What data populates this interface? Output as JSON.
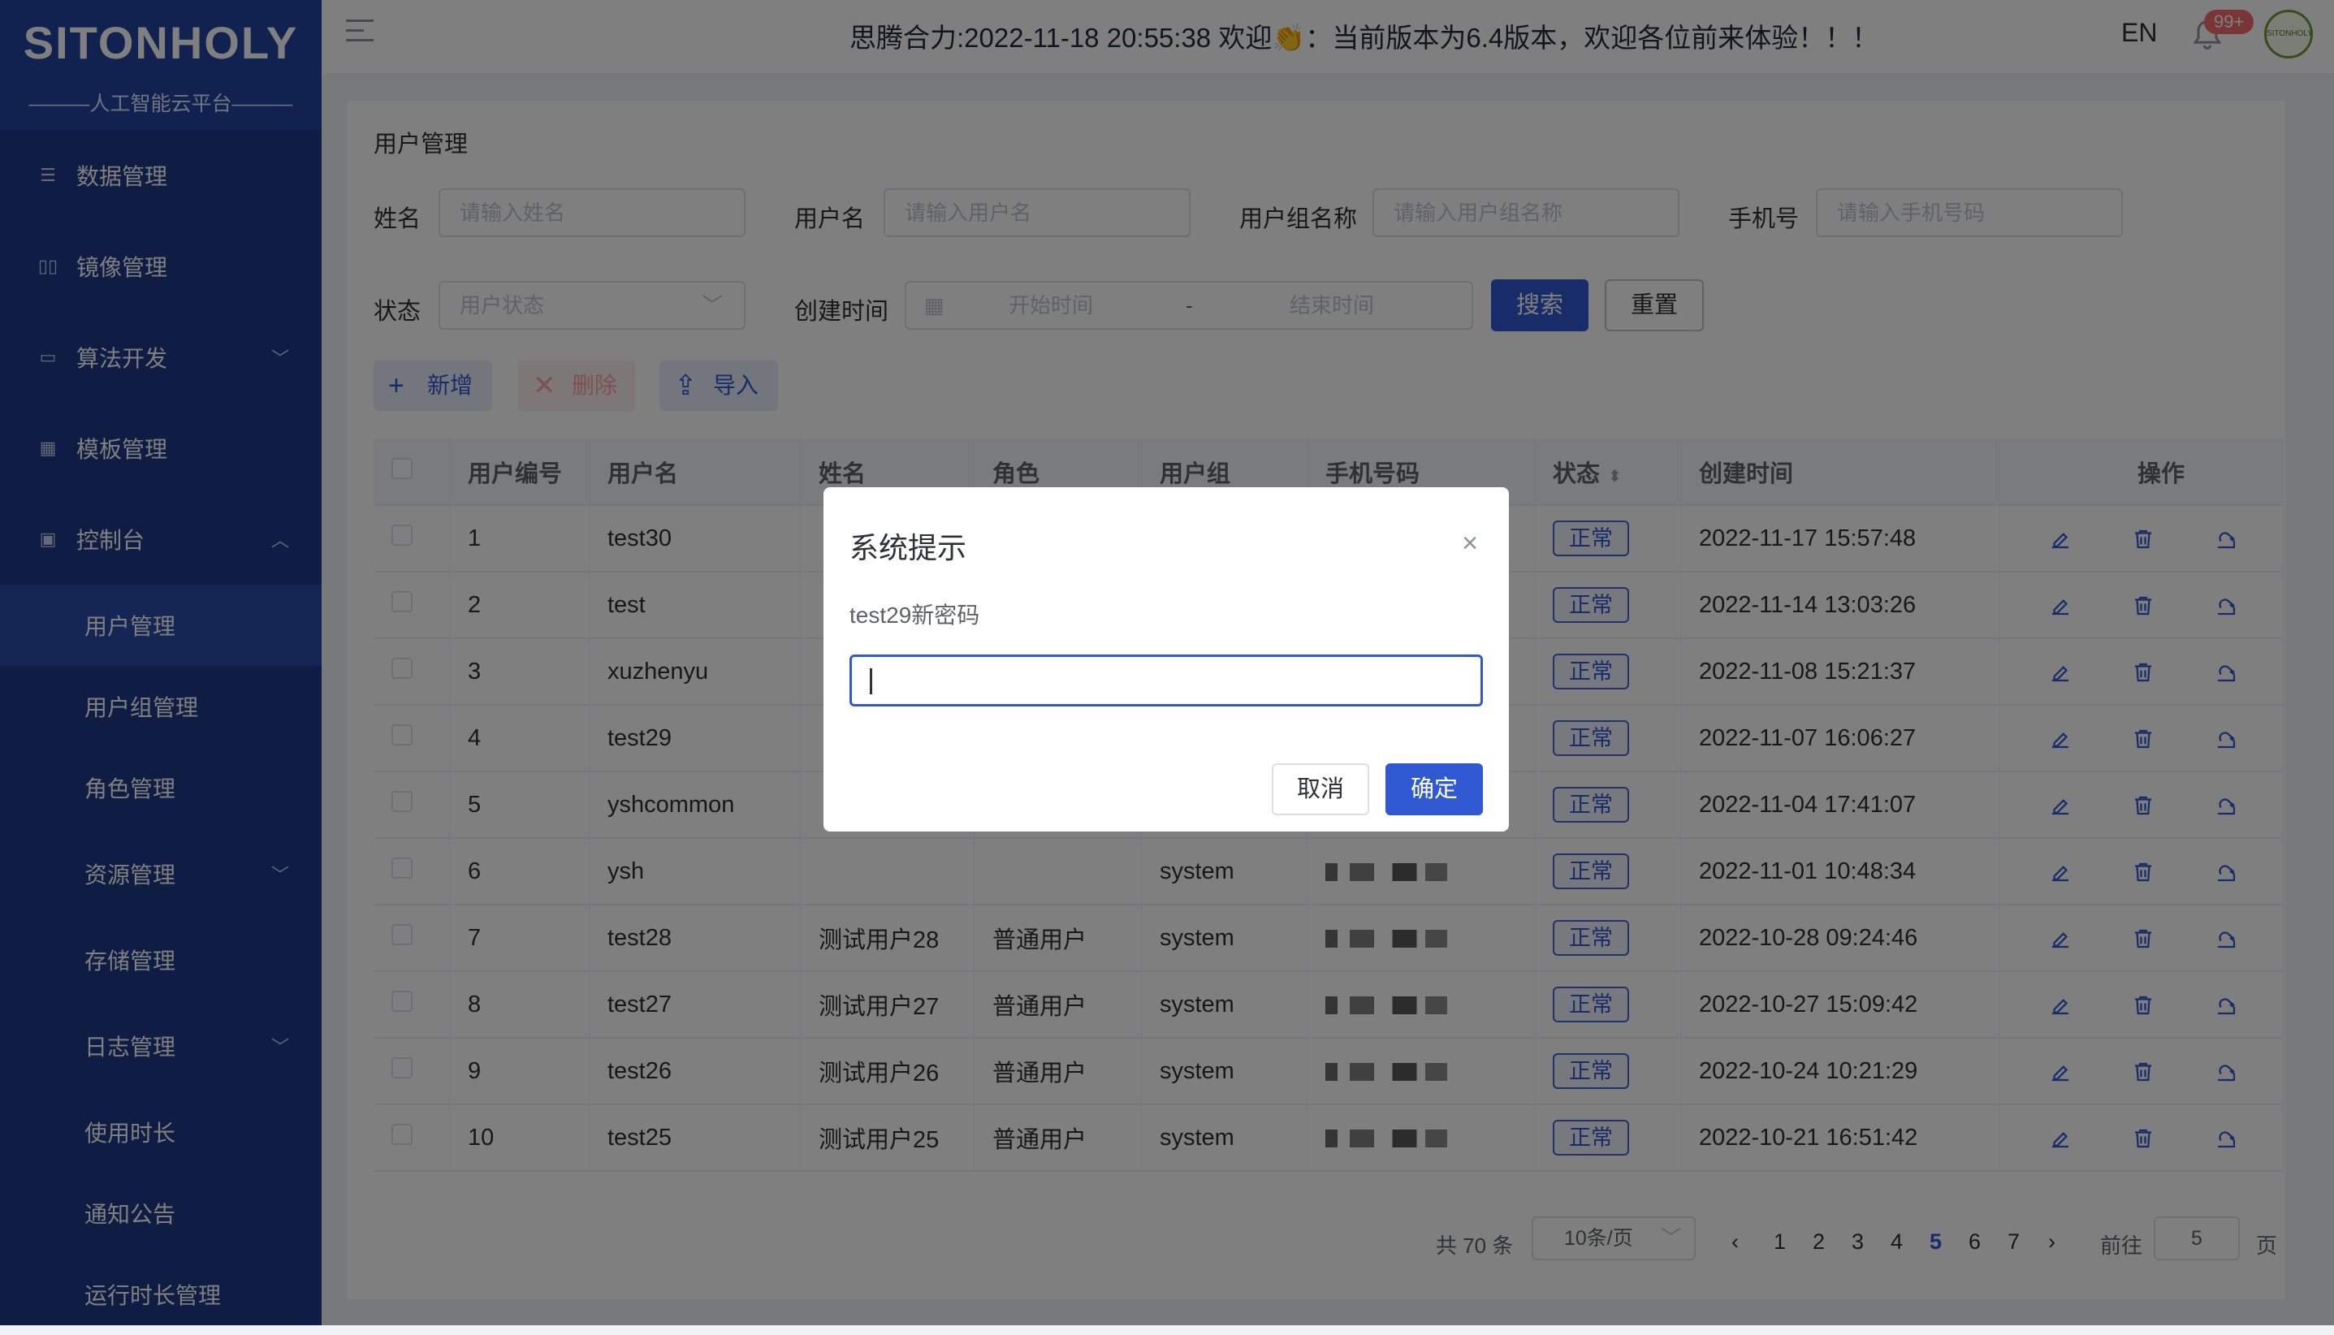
{
  "sidebar": {
    "brand": "SITONHOLY",
    "subtitle": "———人工智能云平台———",
    "items": [
      {
        "label": "数据管理",
        "icon": "list-icon"
      },
      {
        "label": "镜像管理",
        "icon": "book-icon"
      },
      {
        "label": "算法开发",
        "icon": "code-icon",
        "expandable": true
      },
      {
        "label": "模板管理",
        "icon": "grid-icon"
      },
      {
        "label": "控制台",
        "icon": "monitor-icon",
        "expanded": true
      }
    ],
    "subitems": [
      {
        "label": "用户管理",
        "active": true
      },
      {
        "label": "用户组管理"
      },
      {
        "label": "角色管理"
      },
      {
        "label": "资源管理",
        "expandable": true
      },
      {
        "label": "存储管理"
      },
      {
        "label": "日志管理",
        "expandable": true
      },
      {
        "label": "使用时长"
      },
      {
        "label": "通知公告"
      },
      {
        "label": "运行时长管理"
      }
    ]
  },
  "topbar": {
    "marquee": "思腾合力:2022-11-18 20:55:38 欢迎👏：当前版本为6.4版本，欢迎各位前来体验！！！",
    "lang": "EN",
    "badge": "99+",
    "avatar_text": "SITONHOLY"
  },
  "page": {
    "title": "用户管理"
  },
  "filters": {
    "name_label": "姓名",
    "name_placeholder": "请输入姓名",
    "username_label": "用户名",
    "username_placeholder": "请输入用户名",
    "group_label": "用户组名称",
    "group_placeholder": "请输入用户组名称",
    "phone_label": "手机号",
    "phone_placeholder": "请输入手机号码",
    "status_label": "状态",
    "status_placeholder": "用户状态",
    "created_label": "创建时间",
    "start_placeholder": "开始时间",
    "range_sep": "-",
    "end_placeholder": "结束时间",
    "search": "搜索",
    "reset": "重置"
  },
  "toolbar": {
    "add": "新增",
    "delete": "删除",
    "import": "导入"
  },
  "table": {
    "headers": [
      "用户编号",
      "用户名",
      "姓名",
      "角色",
      "用户组",
      "手机号码",
      "状态",
      "创建时间",
      "操作"
    ],
    "rows": [
      {
        "id": "1",
        "username": "test30",
        "name": "",
        "role": "",
        "group": "",
        "status": "正常",
        "created": "2022-11-17 15:57:48"
      },
      {
        "id": "2",
        "username": "test",
        "name": "",
        "role": "",
        "group": "",
        "status": "正常",
        "created": "2022-11-14 13:03:26"
      },
      {
        "id": "3",
        "username": "xuzhenyu",
        "name": "",
        "role": "",
        "group": "",
        "status": "正常",
        "created": "2022-11-08 15:21:37"
      },
      {
        "id": "4",
        "username": "test29",
        "name": "",
        "role": "",
        "group": "",
        "status": "正常",
        "created": "2022-11-07 16:06:27"
      },
      {
        "id": "5",
        "username": "yshcommon",
        "name": "",
        "role": "",
        "group": "",
        "status": "正常",
        "created": "2022-11-04 17:41:07"
      },
      {
        "id": "6",
        "username": "ysh",
        "name": "",
        "role": "",
        "group": "system",
        "status": "正常",
        "created": "2022-11-01 10:48:34"
      },
      {
        "id": "7",
        "username": "test28",
        "name": "测试用户28",
        "role": "普通用户",
        "group": "system",
        "status": "正常",
        "created": "2022-10-28 09:24:46"
      },
      {
        "id": "8",
        "username": "test27",
        "name": "测试用户27",
        "role": "普通用户",
        "group": "system",
        "status": "正常",
        "created": "2022-10-27 15:09:42"
      },
      {
        "id": "9",
        "username": "test26",
        "name": "测试用户26",
        "role": "普通用户",
        "group": "system",
        "status": "正常",
        "created": "2022-10-24 10:21:29"
      },
      {
        "id": "10",
        "username": "test25",
        "name": "测试用户25",
        "role": "普通用户",
        "group": "system",
        "status": "正常",
        "created": "2022-10-21 16:51:42"
      }
    ]
  },
  "pagination": {
    "total": "共 70 条",
    "page_size": "10条/页",
    "pages": [
      "1",
      "2",
      "3",
      "4",
      "5",
      "6",
      "7"
    ],
    "current": "5",
    "goto_label": "前往",
    "goto_value": "5",
    "goto_suffix": "页"
  },
  "dialog": {
    "title": "系统提示",
    "message": "test29新密码",
    "input_value": "",
    "cancel": "取消",
    "confirm": "确定"
  },
  "colors": {
    "sidebar": "#1e3a8a",
    "primary": "#2f58d1",
    "danger": "#f56c6c"
  }
}
